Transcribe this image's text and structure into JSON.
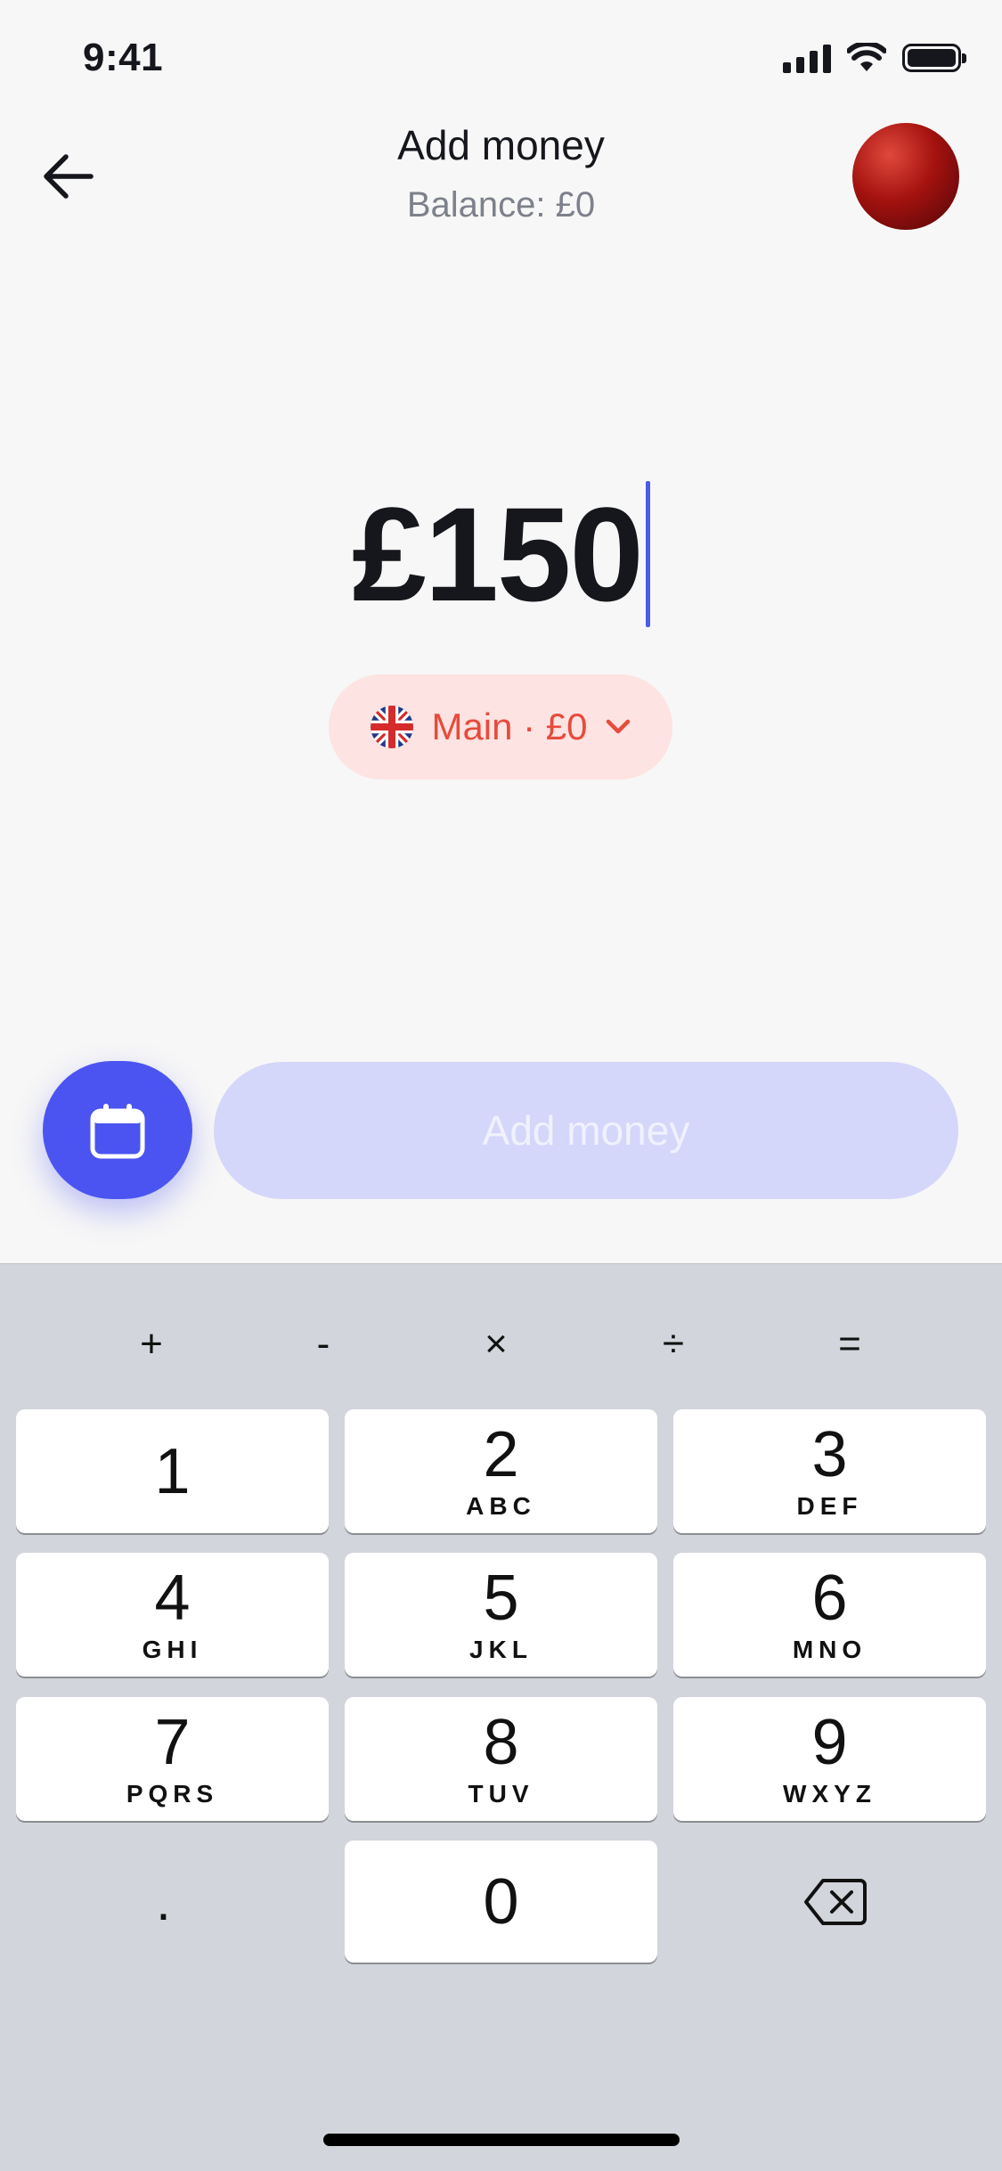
{
  "status_bar": {
    "time": "9:41",
    "icons": [
      "cellular-signal-icon",
      "wifi-icon",
      "battery-icon"
    ]
  },
  "header": {
    "title": "Add money",
    "subtitle": "Balance: £0",
    "back_icon": "arrow-left-icon",
    "avatar": "profile-avatar"
  },
  "amount": {
    "value": "£150"
  },
  "account": {
    "label": "Main · £0",
    "flag_icon": "uk-flag-icon",
    "chevron_icon": "chevron-down-icon"
  },
  "actions": {
    "schedule_icon": "calendar-icon",
    "add_label": "Add money"
  },
  "keyboard": {
    "operators": [
      "+",
      "-",
      "×",
      "÷",
      "="
    ],
    "keys": [
      {
        "num": "1",
        "letters": ""
      },
      {
        "num": "2",
        "letters": "ABC"
      },
      {
        "num": "3",
        "letters": "DEF"
      },
      {
        "num": "4",
        "letters": "GHI"
      },
      {
        "num": "5",
        "letters": "JKL"
      },
      {
        "num": "6",
        "letters": "MNO"
      },
      {
        "num": "7",
        "letters": "PQRS"
      },
      {
        "num": "8",
        "letters": "TUV"
      },
      {
        "num": "9",
        "letters": "WXYZ"
      }
    ],
    "decimal": ".",
    "zero": "0",
    "delete_icon": "backspace-icon"
  },
  "colors": {
    "accent": "#4b54f0",
    "account_pill_bg": "#fde3e1",
    "account_pill_text": "#e64b3c",
    "disabled_button_bg": "#d4d6fa",
    "keyboard_bg": "#d2d5db"
  }
}
